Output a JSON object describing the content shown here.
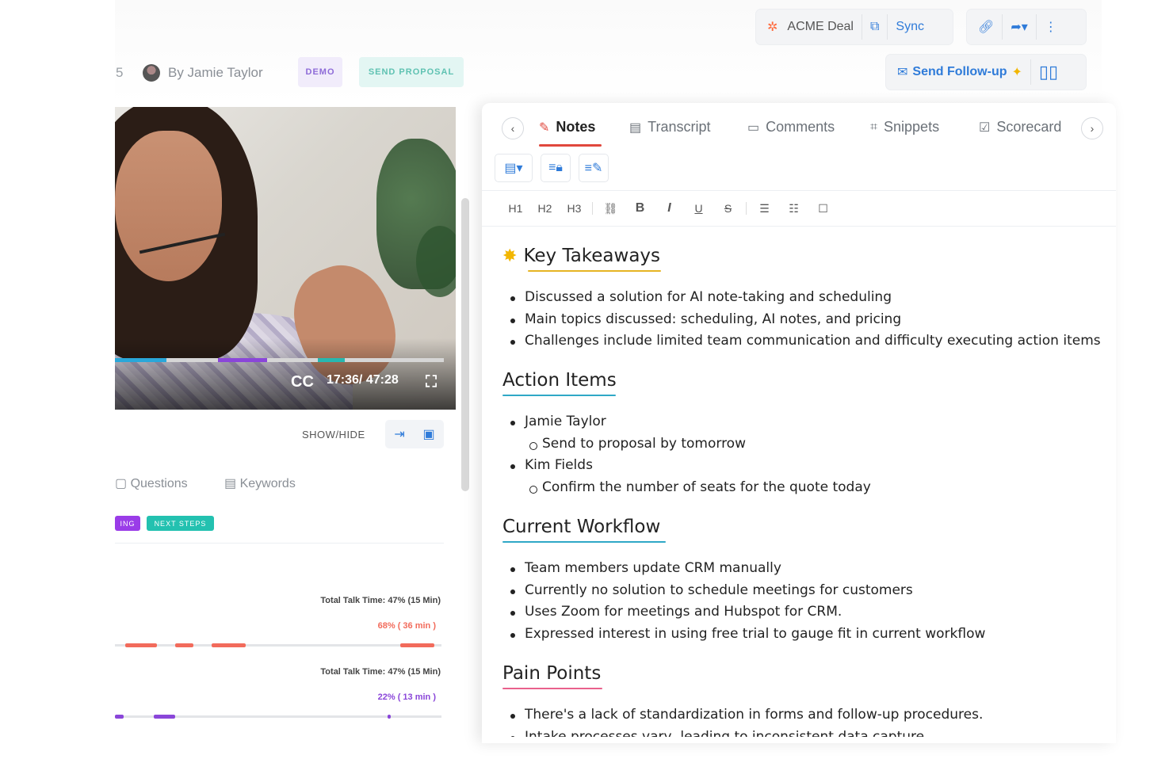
{
  "toolbar": {
    "deal_label": "ACME Deal",
    "sync_label": "Sync",
    "followup_label": "Send Follow-up"
  },
  "header": {
    "count": "5",
    "by": "By Jamie Taylor",
    "tags": [
      "DEMO",
      "SEND PROPOSAL"
    ]
  },
  "video": {
    "cc": "CC",
    "time": "17:36/ 47:28",
    "showhide": "SHOW/HIDE"
  },
  "left_tabs": {
    "questions": "Questions",
    "keywords": "Keywords"
  },
  "chips": [
    "ING",
    "NEXT STEPS"
  ],
  "talk": [
    {
      "label": "Total Talk Time: 47% (15 Min)",
      "pct": "68% ( 36 min )",
      "color": "#f26b5b"
    },
    {
      "label": "Total Talk Time: 47% (15 Min)",
      "pct": "22% ( 13 min )",
      "color": "#8a46d9"
    }
  ],
  "panel": {
    "tabs": [
      "Notes",
      "Transcript",
      "Comments",
      "Snippets",
      "Scorecard"
    ],
    "active_tab": "Notes",
    "format": [
      "H1",
      "H2",
      "H3"
    ]
  },
  "notes": {
    "key_takeaways": {
      "title": "Key Takeaways",
      "items": [
        "Discussed a solution for AI note-taking and scheduling",
        "Main topics discussed: scheduling, AI notes, and pricing",
        "Challenges include limited team communication and difficulty executing action items"
      ]
    },
    "action_items": {
      "title": "Action Items",
      "items": [
        "Jamie Taylor",
        "Send to proposal by tomorrow",
        "Kim Fields",
        "Confirm the number of seats for the quote today"
      ]
    },
    "current_workflow": {
      "title": "Current Workflow",
      "items": [
        "Team members update CRM manually",
        "Currently no solution to schedule meetings for customers",
        "Uses Zoom for meetings and Hubspot for CRM.",
        "Expressed interest in using free trial to gauge fit in current workflow"
      ]
    },
    "pain_points": {
      "title": "Pain Points",
      "items": [
        "There's a lack of standardization in forms and follow-up procedures.",
        "Intake processes vary, leading to inconsistent data capture."
      ]
    }
  },
  "colors": {
    "accent_blue": "#2f7bd9",
    "notes_red": "#e0473d",
    "heading_gold": "#e6b422",
    "heading_teal": "#2fa8c7",
    "heading_pink": "#e9608c"
  }
}
